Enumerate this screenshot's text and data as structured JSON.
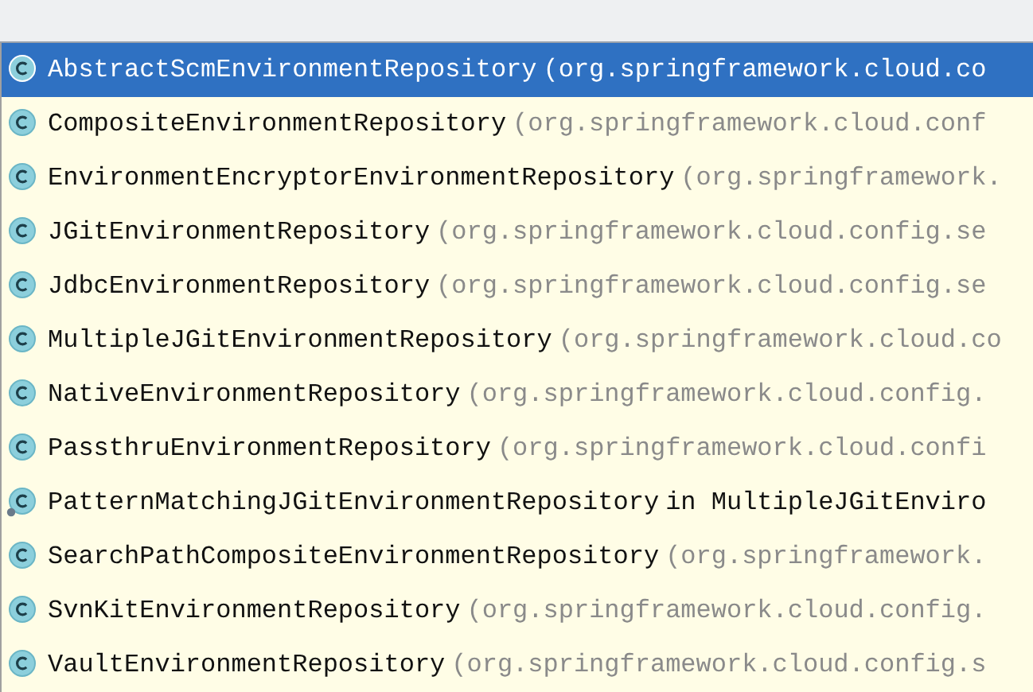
{
  "items": [
    {
      "name": "AbstractScmEnvironmentRepository",
      "location": "(org.springframework.cloud.co",
      "kind": "class",
      "selected": true
    },
    {
      "name": "CompositeEnvironmentRepository",
      "location": "(org.springframework.cloud.conf",
      "kind": "class",
      "selected": false
    },
    {
      "name": "EnvironmentEncryptorEnvironmentRepository",
      "location": "(org.springframework.",
      "kind": "class",
      "selected": false
    },
    {
      "name": "JGitEnvironmentRepository",
      "location": "(org.springframework.cloud.config.se",
      "kind": "class",
      "selected": false
    },
    {
      "name": "JdbcEnvironmentRepository",
      "location": "(org.springframework.cloud.config.se",
      "kind": "class",
      "selected": false
    },
    {
      "name": "MultipleJGitEnvironmentRepository",
      "location": "(org.springframework.cloud.co",
      "kind": "class",
      "selected": false
    },
    {
      "name": "NativeEnvironmentRepository",
      "location": "(org.springframework.cloud.config.",
      "kind": "class",
      "selected": false
    },
    {
      "name": "PassthruEnvironmentRepository",
      "location": "(org.springframework.cloud.confi",
      "kind": "class",
      "selected": false
    },
    {
      "name": "PatternMatchingJGitEnvironmentRepository",
      "location": "in MultipleJGitEnviro",
      "kind": "inner",
      "selected": false
    },
    {
      "name": "SearchPathCompositeEnvironmentRepository",
      "location": "(org.springframework.",
      "kind": "class",
      "selected": false
    },
    {
      "name": "SvnKitEnvironmentRepository",
      "location": "(org.springframework.cloud.config.",
      "kind": "class",
      "selected": false
    },
    {
      "name": "VaultEnvironmentRepository",
      "location": "(org.springframework.cloud.config.s",
      "kind": "class",
      "selected": false
    }
  ]
}
